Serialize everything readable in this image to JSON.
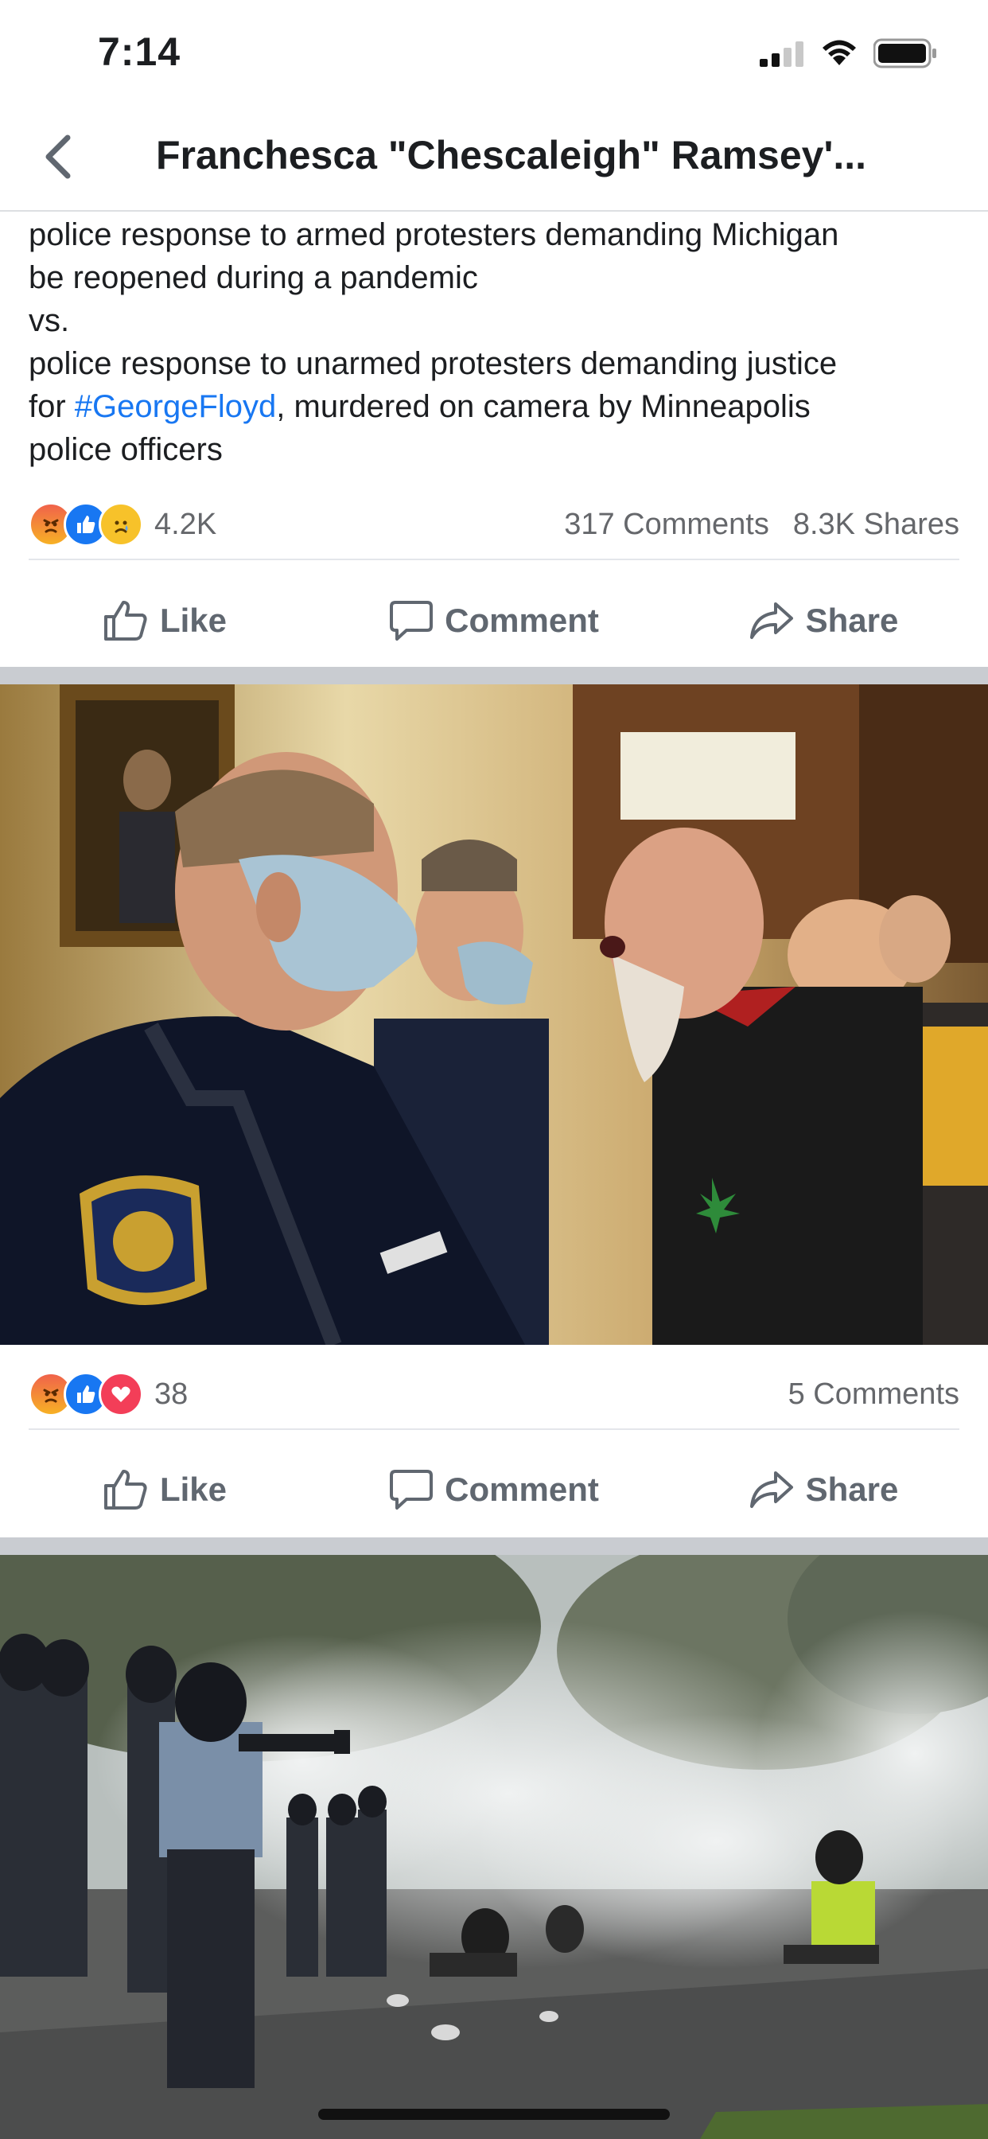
{
  "status_bar": {
    "time": "7:14"
  },
  "header": {
    "title": "Franchesca \"Chescaleigh\" Ramsey'..."
  },
  "post": {
    "line1": "police response to armed protesters demanding Michigan",
    "line2": "be reopened during a pandemic",
    "line3": "vs.",
    "line4": "police response to unarmed protesters demanding justice",
    "line5_prefix": "for ",
    "hashtag": "#GeorgeFloyd",
    "line5_suffix": ", murdered on camera by Minneapolis",
    "line6": "police officers",
    "reactions": [
      "angry",
      "like",
      "sad"
    ],
    "reaction_count": "4.2K",
    "comments": "317 Comments",
    "shares": "8.3K Shares"
  },
  "photo1": {
    "reactions": [
      "angry",
      "like",
      "love"
    ],
    "reaction_count": "38",
    "comments": "5 Comments"
  },
  "actions": {
    "like": "Like",
    "comment": "Comment",
    "share": "Share"
  },
  "colors": {
    "link": "#1877f2",
    "like_blue": "#1877f2",
    "love_red": "#f33e58",
    "text_gray": "#65676b"
  }
}
